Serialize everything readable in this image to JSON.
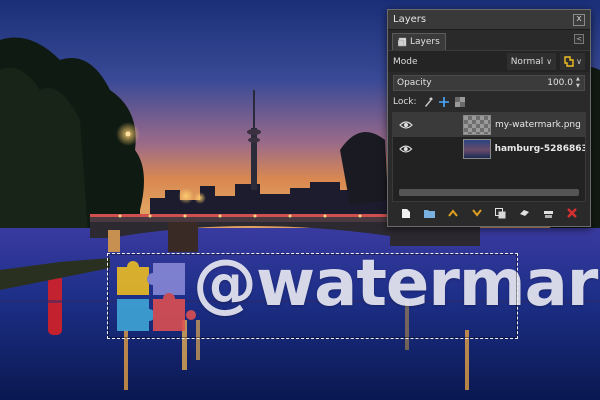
{
  "watermark": {
    "text": "@watermark"
  },
  "dialog": {
    "title": "Layers",
    "close_label": "x",
    "tab_label": "Layers",
    "tab_menu": "<",
    "mode_label": "Mode",
    "mode_value": "Normal",
    "opacity_label": "Opacity",
    "opacity_value": "100.0",
    "lock_label": "Lock:",
    "layers": [
      {
        "name": "my-watermark.png",
        "visible": true,
        "selected": true,
        "thumb": "transparent"
      },
      {
        "name": "hamburg-5286863",
        "visible": true,
        "selected": false,
        "thumb": "photo"
      }
    ],
    "toolbar_icons": [
      "new-layer-icon",
      "layer-group-icon",
      "raise-layer-icon",
      "lower-layer-icon",
      "duplicate-layer-icon",
      "anchor-layer-icon",
      "merge-down-icon",
      "delete-layer-icon"
    ],
    "colors": {
      "accent_orange": "#e0a020",
      "delete_red": "#d83030",
      "lock_blue": "#4aa8ff"
    }
  }
}
